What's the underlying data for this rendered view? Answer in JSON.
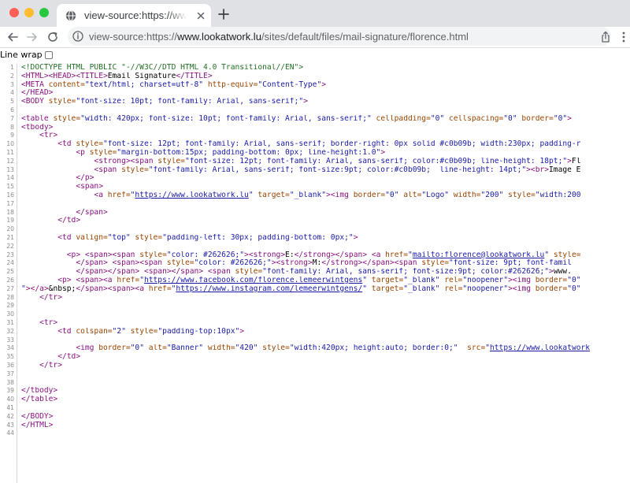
{
  "window": {
    "traffic_lights": {
      "close_color": "#ff5f57",
      "minimize_color": "#febc2e",
      "zoom_color": "#28c840"
    },
    "tab_title": "view-source:https://www.lookatwork.lu/sites/default/files/mail-signature/florence.html",
    "url": {
      "prefix": "view-source:https://",
      "host": "www.lookatwork.lu",
      "path": "/sites/default/files/mail-signature/florence.html"
    },
    "icons": {
      "favicon": "globe-icon",
      "tab_close": "close-icon",
      "new_tab": "plus-icon",
      "back": "back-arrow-icon",
      "forward": "forward-arrow-icon",
      "reload": "reload-icon",
      "site_info": "info-icon",
      "share": "share-icon",
      "menu": "more-vert-icon"
    }
  },
  "view_source": {
    "line_wrap_label": "Line wrap",
    "line_wrap_checked": false,
    "colors": {
      "tag": "#881280",
      "attribute": "#994500",
      "value": "#1a1aa6",
      "comment": "#236e25"
    },
    "lines": [
      {
        "n": "1",
        "t": [
          [
            "cmt",
            "<!DOCTYPE HTML PUBLIC \"-//W3C//DTD HTML 4.0 Transitional//EN\">"
          ]
        ]
      },
      {
        "n": "2",
        "t": [
          [
            "tag",
            "<HTML>"
          ],
          [
            "tag",
            "<HEAD>"
          ],
          [
            "tag",
            "<TITLE>"
          ],
          [
            "txt",
            "Email Signature"
          ],
          [
            "tag",
            "</TITLE>"
          ]
        ]
      },
      {
        "n": "3",
        "t": [
          [
            "tag",
            "<META "
          ],
          [
            "attr",
            "content="
          ],
          [
            "val",
            "\"text/html; charset=utf-8\""
          ],
          [
            "attr",
            " http-equiv="
          ],
          [
            "val",
            "\"Content-Type\""
          ],
          [
            "tag",
            ">"
          ]
        ]
      },
      {
        "n": "4",
        "t": [
          [
            "tag",
            "</HEAD>"
          ]
        ]
      },
      {
        "n": "5",
        "t": [
          [
            "tag",
            "<BODY "
          ],
          [
            "attr",
            "style="
          ],
          [
            "val",
            "\"font-size: 10pt; font-family: Arial, sans-serif;\""
          ],
          [
            "tag",
            ">"
          ]
        ]
      },
      {
        "n": "6",
        "t": []
      },
      {
        "n": "7",
        "t": [
          [
            "tag",
            "<table "
          ],
          [
            "attr",
            "style="
          ],
          [
            "val",
            "\"width: 420px; font-size: 10pt; font-family: Arial, sans-serif;\""
          ],
          [
            "attr",
            " cellpadding="
          ],
          [
            "val",
            "\"0\""
          ],
          [
            "attr",
            " cellspacing="
          ],
          [
            "val",
            "\"0\""
          ],
          [
            "attr",
            " border="
          ],
          [
            "val",
            "\"0\""
          ],
          [
            "tag",
            ">"
          ]
        ]
      },
      {
        "n": "8",
        "t": [
          [
            "tag",
            "<tbody>"
          ]
        ]
      },
      {
        "n": "9",
        "t": [
          [
            "txt",
            "    "
          ],
          [
            "tag",
            "<tr>"
          ]
        ]
      },
      {
        "n": "10",
        "t": [
          [
            "txt",
            "        "
          ],
          [
            "tag",
            "<td "
          ],
          [
            "attr",
            "style="
          ],
          [
            "val",
            "\"font-size: 12pt; font-family: Arial, sans-serif; border-right: 0px solid #c0b09b; width:230px; padding-r"
          ]
        ]
      },
      {
        "n": "11",
        "t": [
          [
            "txt",
            "            "
          ],
          [
            "tag",
            "<p "
          ],
          [
            "attr",
            "style="
          ],
          [
            "val",
            "\"margin-bottom:15px; padding-bottom: 0px; line-height:1.0\""
          ],
          [
            "tag",
            ">"
          ]
        ]
      },
      {
        "n": "12",
        "t": [
          [
            "txt",
            "                "
          ],
          [
            "tag",
            "<strong>"
          ],
          [
            "tag",
            "<span "
          ],
          [
            "attr",
            "style="
          ],
          [
            "val",
            "\"font-size: 12pt; font-family: Arial, sans-serif; color:#c0b09b; line-height: 18pt;\""
          ],
          [
            "tag",
            ">"
          ],
          [
            "txt",
            "Fl"
          ]
        ]
      },
      {
        "n": "13",
        "t": [
          [
            "txt",
            "                "
          ],
          [
            "tag",
            "<span "
          ],
          [
            "attr",
            "style="
          ],
          [
            "val",
            "\"font-family: Arial, sans-serif; font-size:9pt; color:#c0b09b;  line-height: 14pt;\""
          ],
          [
            "tag",
            ">"
          ],
          [
            "tag",
            "<br>"
          ],
          [
            "txt",
            "Image E"
          ]
        ]
      },
      {
        "n": "14",
        "t": [
          [
            "txt",
            "            "
          ],
          [
            "tag",
            "</p>"
          ]
        ]
      },
      {
        "n": "15",
        "t": [
          [
            "txt",
            "            "
          ],
          [
            "tag",
            "<span>"
          ]
        ]
      },
      {
        "n": "16",
        "t": [
          [
            "txt",
            "                "
          ],
          [
            "tag",
            "<a "
          ],
          [
            "attr",
            "href="
          ],
          [
            "val",
            "\""
          ],
          [
            "lnk",
            "https://www.lookatwork.lu"
          ],
          [
            "val",
            "\""
          ],
          [
            "attr",
            " target="
          ],
          [
            "val",
            "\"_blank\""
          ],
          [
            "tag",
            ">"
          ],
          [
            "tag",
            "<img "
          ],
          [
            "attr",
            "border="
          ],
          [
            "val",
            "\"0\""
          ],
          [
            "attr",
            " alt="
          ],
          [
            "val",
            "\"Logo\""
          ],
          [
            "attr",
            " width="
          ],
          [
            "val",
            "\"200\""
          ],
          [
            "attr",
            " style="
          ],
          [
            "val",
            "\"width:200"
          ]
        ]
      },
      {
        "n": "17",
        "t": []
      },
      {
        "n": "18",
        "t": [
          [
            "txt",
            "            "
          ],
          [
            "tag",
            "</span>"
          ]
        ]
      },
      {
        "n": "19",
        "t": [
          [
            "txt",
            "        "
          ],
          [
            "tag",
            "</td>"
          ]
        ]
      },
      {
        "n": "20",
        "t": []
      },
      {
        "n": "21",
        "t": [
          [
            "txt",
            "        "
          ],
          [
            "tag",
            "<td "
          ],
          [
            "attr",
            "valign="
          ],
          [
            "val",
            "\"top\""
          ],
          [
            "attr",
            " style="
          ],
          [
            "val",
            "\"padding-left: 30px; padding-bottom: 0px;\""
          ],
          [
            "tag",
            ">"
          ]
        ]
      },
      {
        "n": "22",
        "t": []
      },
      {
        "n": "23",
        "t": [
          [
            "txt",
            "          "
          ],
          [
            "tag",
            "<p> "
          ],
          [
            "tag",
            "<span>"
          ],
          [
            "tag",
            "<span "
          ],
          [
            "attr",
            "style="
          ],
          [
            "val",
            "\"color: #262626;\""
          ],
          [
            "tag",
            ">"
          ],
          [
            "tag",
            "<strong>"
          ],
          [
            "txt",
            "E:"
          ],
          [
            "tag",
            "</strong>"
          ],
          [
            "tag",
            "</span> "
          ],
          [
            "tag",
            "<a "
          ],
          [
            "attr",
            "href="
          ],
          [
            "val",
            "\""
          ],
          [
            "lnk",
            "mailto:florence@lookatwork.lu"
          ],
          [
            "val",
            "\""
          ],
          [
            "attr",
            " style="
          ]
        ]
      },
      {
        "n": "24",
        "t": [
          [
            "txt",
            "            "
          ],
          [
            "tag",
            "</span> "
          ],
          [
            "tag",
            "<span>"
          ],
          [
            "tag",
            "<span "
          ],
          [
            "attr",
            "style="
          ],
          [
            "val",
            "\"color: #262626;\""
          ],
          [
            "tag",
            ">"
          ],
          [
            "tag",
            "<strong>"
          ],
          [
            "txt",
            "M:"
          ],
          [
            "tag",
            "</strong>"
          ],
          [
            "tag",
            "</span>"
          ],
          [
            "tag",
            "<span "
          ],
          [
            "attr",
            "style="
          ],
          [
            "val",
            "\"font-size: 9pt; font-famil"
          ]
        ]
      },
      {
        "n": "25",
        "t": [
          [
            "txt",
            "            "
          ],
          [
            "tag",
            "</span>"
          ],
          [
            "tag",
            "</span> "
          ],
          [
            "tag",
            "<span>"
          ],
          [
            "tag",
            "</span> "
          ],
          [
            "tag",
            "<span "
          ],
          [
            "attr",
            "style="
          ],
          [
            "val",
            "\"font-family: Arial, sans-serif; font-size:9pt; color:#262626;\""
          ],
          [
            "tag",
            ">"
          ],
          [
            "txt",
            "www."
          ]
        ]
      },
      {
        "n": "26",
        "t": [
          [
            "txt",
            "        "
          ],
          [
            "tag",
            "<p> "
          ],
          [
            "tag",
            "<span>"
          ],
          [
            "tag",
            "<a "
          ],
          [
            "attr",
            "href="
          ],
          [
            "val",
            "\""
          ],
          [
            "lnk",
            "https://www.facebook.com/florence.lemeerwintgens"
          ],
          [
            "val",
            "\""
          ],
          [
            "attr",
            " target="
          ],
          [
            "val",
            "\"_blank\""
          ],
          [
            "attr",
            " rel="
          ],
          [
            "val",
            "\"noopener\""
          ],
          [
            "tag",
            ">"
          ],
          [
            "tag",
            "<img "
          ],
          [
            "attr",
            "border="
          ],
          [
            "val",
            "\"0\""
          ]
        ]
      },
      {
        "n": "27",
        "t": [
          [
            "val",
            "\""
          ],
          [
            "tag",
            ">"
          ],
          [
            "tag",
            "</a>"
          ],
          [
            "txt",
            "&nbsp;"
          ],
          [
            "tag",
            "</span>"
          ],
          [
            "tag",
            "<span>"
          ],
          [
            "tag",
            "<a "
          ],
          [
            "attr",
            "href="
          ],
          [
            "val",
            "\""
          ],
          [
            "lnk",
            "https://www.instagram.com/lemeerwintgens/"
          ],
          [
            "val",
            "\""
          ],
          [
            "attr",
            " target="
          ],
          [
            "val",
            "\"_blank\""
          ],
          [
            "attr",
            " rel="
          ],
          [
            "val",
            "\"noopener\""
          ],
          [
            "tag",
            ">"
          ],
          [
            "tag",
            "<img "
          ],
          [
            "attr",
            "border="
          ],
          [
            "val",
            "\"0\""
          ]
        ]
      },
      {
        "n": "28",
        "t": [
          [
            "txt",
            "    "
          ],
          [
            "tag",
            "</tr>"
          ]
        ]
      },
      {
        "n": "29",
        "t": []
      },
      {
        "n": "30",
        "t": []
      },
      {
        "n": "31",
        "t": [
          [
            "txt",
            "    "
          ],
          [
            "tag",
            "<tr>"
          ]
        ]
      },
      {
        "n": "32",
        "t": [
          [
            "txt",
            "        "
          ],
          [
            "tag",
            "<td "
          ],
          [
            "attr",
            "colspan="
          ],
          [
            "val",
            "\"2\""
          ],
          [
            "attr",
            " style="
          ],
          [
            "val",
            "\"padding-top:10px\""
          ],
          [
            "tag",
            ">"
          ]
        ]
      },
      {
        "n": "33",
        "t": []
      },
      {
        "n": "34",
        "t": [
          [
            "txt",
            "            "
          ],
          [
            "tag",
            "<img "
          ],
          [
            "attr",
            "border="
          ],
          [
            "val",
            "\"0\""
          ],
          [
            "attr",
            " alt="
          ],
          [
            "val",
            "\"Banner\""
          ],
          [
            "attr",
            " width="
          ],
          [
            "val",
            "\"420\""
          ],
          [
            "attr",
            " style="
          ],
          [
            "val",
            "\"width:420px; height:auto; border:0;\""
          ],
          [
            "attr",
            "  src="
          ],
          [
            "val",
            "\""
          ],
          [
            "lnk",
            "https://www.lookatwork"
          ]
        ]
      },
      {
        "n": "35",
        "t": [
          [
            "txt",
            "        "
          ],
          [
            "tag",
            "</td>"
          ]
        ]
      },
      {
        "n": "36",
        "t": [
          [
            "txt",
            "    "
          ],
          [
            "tag",
            "</tr>"
          ]
        ]
      },
      {
        "n": "37",
        "t": []
      },
      {
        "n": "38",
        "t": []
      },
      {
        "n": "39",
        "t": [
          [
            "tag",
            "</tbody>"
          ]
        ]
      },
      {
        "n": "40",
        "t": [
          [
            "tag",
            "</table>"
          ]
        ]
      },
      {
        "n": "41",
        "t": []
      },
      {
        "n": "42",
        "t": [
          [
            "tag",
            "</BODY>"
          ]
        ]
      },
      {
        "n": "43",
        "t": [
          [
            "tag",
            "</HTML>"
          ]
        ]
      },
      {
        "n": "44",
        "t": []
      }
    ]
  }
}
